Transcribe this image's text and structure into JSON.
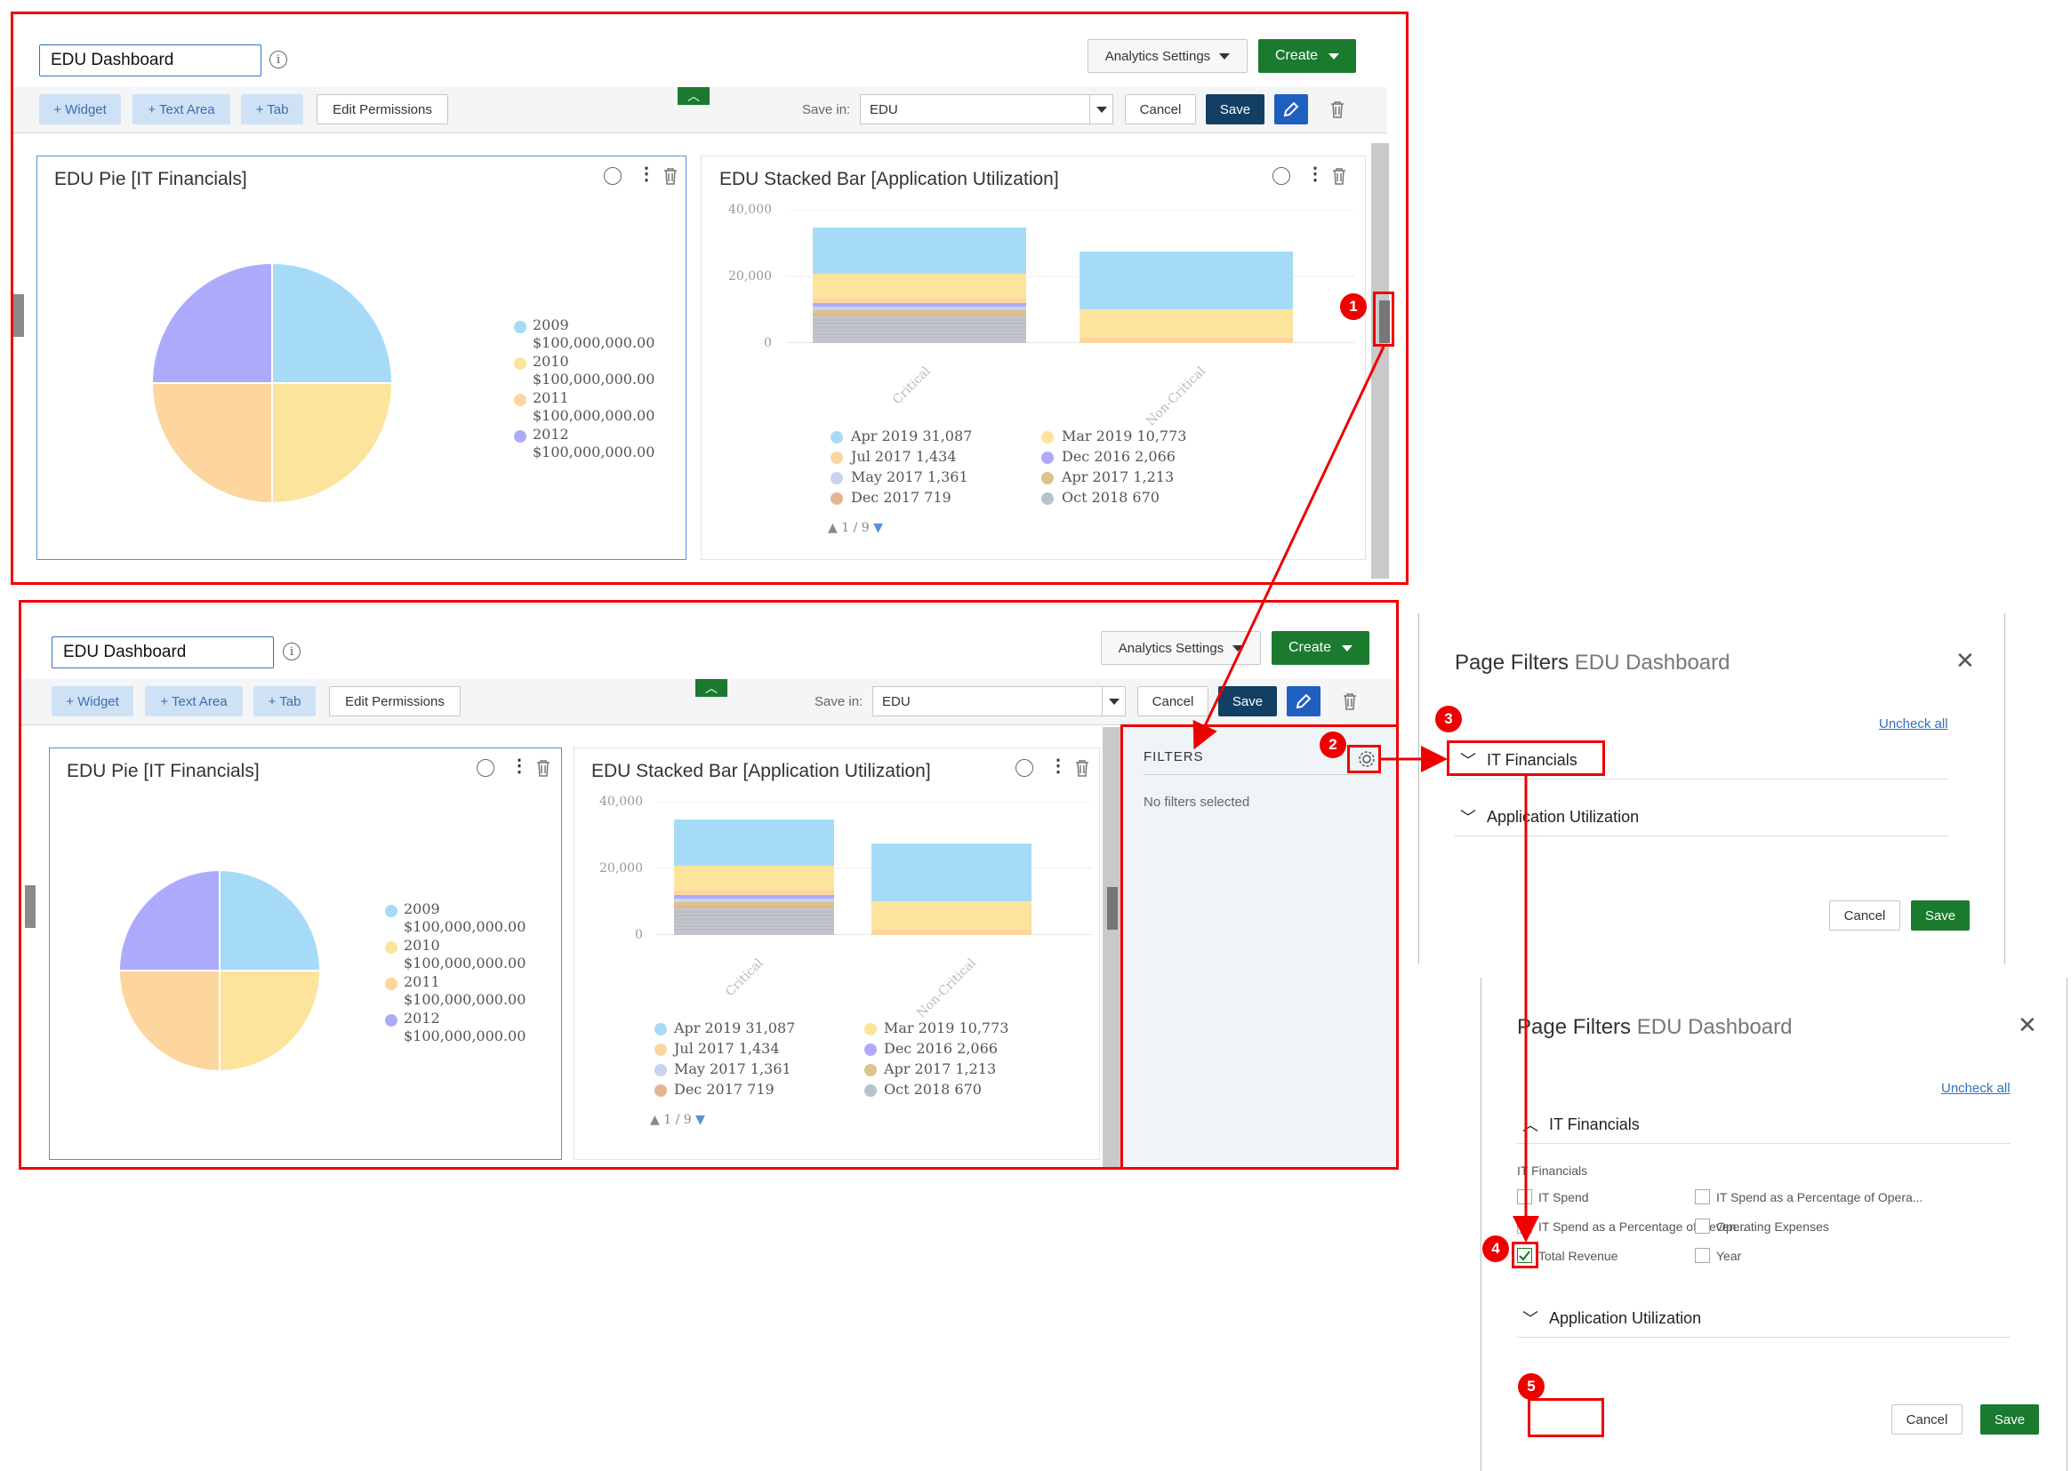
{
  "dashboard": {
    "title_value": "EDU Dashboard",
    "info_icon": "i",
    "analytics_settings": "Analytics Settings",
    "create": "Create",
    "toolbar": {
      "widget": "+ Widget",
      "text_area": "+ Text Area",
      "tab": "+ Tab",
      "edit_permissions": "Edit Permissions",
      "save_in_label": "Save in:",
      "save_in_value": "EDU",
      "cancel": "Cancel",
      "save": "Save"
    }
  },
  "pie_widget": {
    "title": "EDU Pie [IT Financials]",
    "legend": [
      {
        "year": "2009",
        "value": "$100,000,000.00",
        "color": "#a6dbf8"
      },
      {
        "year": "2010",
        "value": "$100,000,000.00",
        "color": "#fde49c"
      },
      {
        "year": "2011",
        "value": "$100,000,000.00",
        "color": "#fdd59e"
      },
      {
        "year": "2012",
        "value": "$100,000,000.00",
        "color": "#aeaafb"
      }
    ]
  },
  "bar_widget": {
    "title": "EDU Stacked Bar [Application Utilization]",
    "y_ticks": [
      "40,000",
      "20,000",
      "0"
    ],
    "categories": [
      "Critical",
      "Non-Critical"
    ],
    "legend_left": [
      "Apr 2019 31,087",
      "Jul 2017 1,434",
      "May 2017 1,361",
      "Dec 2017 719"
    ],
    "legend_right": [
      "Mar 2019 10,773",
      "Dec 2016 2,066",
      "Apr 2017 1,213",
      "Oct 2018 670"
    ],
    "legend_left_colors": [
      "#a6dbf8",
      "#fdd59e",
      "#c8d4ea",
      "#e5b48e"
    ],
    "legend_right_colors": [
      "#fde49c",
      "#aeaafb",
      "#d9c48a",
      "#b5c3cc"
    ],
    "pager": "1 / 9"
  },
  "filters_panel": {
    "title": "FILTERS",
    "empty": "No filters selected"
  },
  "page_filters_1": {
    "title": "Page Filters",
    "subtitle": "EDU Dashboard",
    "uncheck_all": "Uncheck all",
    "sections": [
      "IT Financials",
      "Application Utilization"
    ],
    "cancel": "Cancel",
    "save": "Save"
  },
  "page_filters_2": {
    "title": "Page Filters",
    "subtitle": "EDU Dashboard",
    "uncheck_all": "Uncheck all",
    "section_open": "IT Financials",
    "group_label": "IT Financials",
    "options_left": [
      "IT Spend",
      "IT Spend as a Percentage of Reven...",
      "Total Revenue"
    ],
    "options_right": [
      "IT Spend as a Percentage of Opera...",
      "Operating Expenses",
      "Year"
    ],
    "section_closed": "Application Utilization",
    "cancel": "Cancel",
    "save": "Save"
  },
  "steps": [
    "1",
    "2",
    "3",
    "4",
    "5"
  ]
}
